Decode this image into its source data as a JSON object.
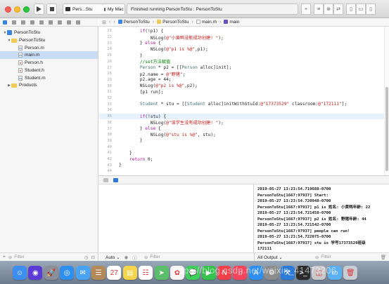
{
  "toolbar": {
    "scheme_target": "Pers...Stu",
    "scheme_device": "My Mac",
    "status": "Finished running PersonToStu : PersonToStu"
  },
  "jumpbar": {
    "crumbs": [
      "PersonToStu",
      "PersonToStu",
      "main.m",
      "main"
    ],
    "separator": "›"
  },
  "navigator": {
    "items": [
      {
        "label": "PersonToStu",
        "type": "project",
        "level": 0,
        "expanded": true
      },
      {
        "label": "PersonToStu",
        "type": "folder",
        "level": 1,
        "expanded": true
      },
      {
        "label": "Person.m",
        "type": "m",
        "level": 2
      },
      {
        "label": "main.m",
        "type": "m",
        "level": 2,
        "selected": true
      },
      {
        "label": "Person.h",
        "type": "h",
        "level": 2
      },
      {
        "label": "Student.h",
        "type": "h",
        "level": 2
      },
      {
        "label": "Student.m",
        "type": "m",
        "level": 2
      },
      {
        "label": "Products",
        "type": "folder",
        "level": 1,
        "expanded": false
      }
    ],
    "filter_placeholder": "Filter"
  },
  "editor": {
    "current_line": 35,
    "lines": [
      {
        "n": "21",
        "html": "        <span class=\"kw\">if</span>(!p1) {"
      },
      {
        "n": "22",
        "html": "            NSLog(<span class=\"str\">@\"小黄鸭没能成功创建! \"</span>);"
      },
      {
        "n": "23",
        "html": "        } <span class=\"kw\">else</span> {"
      },
      {
        "n": "24",
        "html": "            NSLog(<span class=\"str\">@\"p1 is %@\"</span>,p1);"
      },
      {
        "n": "25",
        "html": "        }"
      },
      {
        "n": "26",
        "html": "        <span class=\"cm\">//set方法赋值</span>"
      },
      {
        "n": "27",
        "html": "        <span class=\"cls\">Person</span> * p2 = [[<span class=\"cls\">Person</span> alloc]init];"
      },
      {
        "n": "28",
        "html": "        p2.name = <span class=\"str\">@\"野猪\"</span>;"
      },
      {
        "n": "29",
        "html": "        p2.age = 44;"
      },
      {
        "n": "30",
        "html": "        NSLog(<span class=\"str\">@\"p2 is %@\"</span>,p2);"
      },
      {
        "n": "31",
        "html": "        [p1 run];"
      },
      {
        "n": "32",
        "html": ""
      },
      {
        "n": "33",
        "html": "        <span class=\"cls\">Student</span> * stu = [[<span class=\"cls\">Student</span> alloc]initWithStuId:<span class=\"str\">@\"17373529\"</span> classroom:<span class=\"str\">@\"172111\"</span>];"
      },
      {
        "n": "34",
        "html": ""
      },
      {
        "n": "35",
        "html": "        <span class=\"kw\">if</span>(!stu) {"
      },
      {
        "n": "36",
        "html": "            NSLog(<span class=\"str\">@\"该学生没有成功创建! \"</span>);"
      },
      {
        "n": "37",
        "html": "        } <span class=\"kw\">else</span> {"
      },
      {
        "n": "38",
        "html": "            NSLog(<span class=\"str\">@\"stu is %@\"</span>, stu);"
      },
      {
        "n": "39",
        "html": "        }"
      },
      {
        "n": "40",
        "html": ""
      },
      {
        "n": "41",
        "html": "    }"
      },
      {
        "n": "42",
        "html": "    <span class=\"kw\">return</span> 0;"
      },
      {
        "n": "43",
        "html": "}"
      },
      {
        "n": "44",
        "html": ""
      }
    ]
  },
  "console": {
    "lines": [
      "2019-05-27 13:23:54.719688-0700",
      "PersonToStu[1667:97937] Start:",
      "2019-05-27 13:23:54.720948-0700",
      "PersonToStu[1667:97937] p1 is 姓名: 小黄鸭年龄: 22",
      "2019-05-27 13:23:54.721458-0700",
      "PersonToStu[1667:97937] p2 is 姓名: 野猪年龄: 44",
      "2019-05-27 13:23:54.721542-0700",
      "PersonToStu[1667:97937] people can run!",
      "2019-05-27 13:23:54.722075-0700",
      "PersonToStu[1667:97937] stu is 学号17373529班级",
      "172111",
      "Program ended with exit code: 0"
    ],
    "output_selector": "All Output",
    "filter_placeholder": "Filter"
  },
  "variables": {
    "scope_selector": "Auto",
    "filter_placeholder": "Filter"
  },
  "watermark": "https://blog.csdn.net/weixin_41473206",
  "dock": {
    "icons": [
      {
        "name": "finder-icon",
        "color": "#3d8ef0",
        "glyph": "☺"
      },
      {
        "name": "siri-icon",
        "color": "#5b3bd6",
        "glyph": "◉"
      },
      {
        "name": "launchpad-icon",
        "color": "#8a8f99",
        "glyph": "🚀"
      },
      {
        "name": "safari-icon",
        "color": "#2d8ff0",
        "glyph": "◎"
      },
      {
        "name": "mail-icon",
        "color": "#4aa3f0",
        "glyph": "✉"
      },
      {
        "name": "contacts-icon",
        "color": "#b58a5a",
        "glyph": "☰"
      },
      {
        "name": "calendar-icon",
        "color": "#ffffff",
        "glyph": "27"
      },
      {
        "name": "notes-icon",
        "color": "#f7d54a",
        "glyph": "▤"
      },
      {
        "name": "reminders-icon",
        "color": "#ffffff",
        "glyph": "☷"
      },
      {
        "name": "maps-icon",
        "color": "#5cbd6a",
        "glyph": "➤"
      },
      {
        "name": "photos-icon",
        "color": "#f5f5f5",
        "glyph": "✿"
      },
      {
        "name": "messages-icon",
        "color": "#3ecf5a",
        "glyph": "💬"
      },
      {
        "name": "facetime-icon",
        "color": "#35c24d",
        "glyph": "▶"
      },
      {
        "name": "news-icon",
        "color": "#f0414b",
        "glyph": "N"
      },
      {
        "name": "music-icon",
        "color": "#f5455c",
        "glyph": "♫"
      },
      {
        "name": "appstore-icon",
        "color": "#2e8ef0",
        "glyph": "A"
      },
      {
        "name": "system-preferences-icon",
        "color": "#8c8c8c",
        "glyph": "⚙"
      },
      {
        "name": "xcode-icon",
        "color": "#2d7bd8",
        "glyph": "⚒"
      },
      {
        "name": "terminal-icon",
        "color": "#2b2b2b",
        "glyph": ">_"
      },
      {
        "name": "preview-icon",
        "color": "#c9c9c9",
        "glyph": "◫"
      },
      {
        "name": "folder-icon",
        "color": "#5cb0f0",
        "glyph": "▭"
      },
      {
        "name": "trash-icon",
        "color": "#c8cdd4",
        "glyph": "🗑"
      }
    ]
  }
}
